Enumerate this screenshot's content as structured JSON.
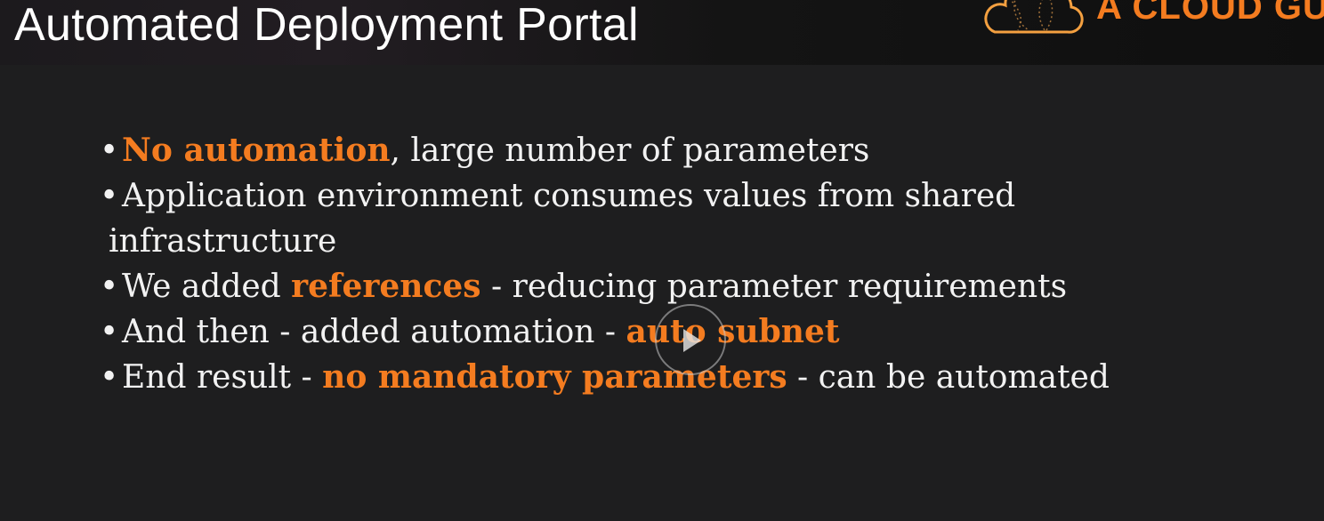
{
  "header": {
    "title": "Automated Deployment Portal",
    "logo_text": "A CLOUD GURU"
  },
  "bullets": [
    {
      "parts": [
        {
          "text": "No automation",
          "highlight": true
        },
        {
          "text": ", large number of parameters"
        }
      ]
    },
    {
      "parts": [
        {
          "text": "Application environment consumes values from shared"
        }
      ],
      "continuation": "infrastructure"
    },
    {
      "parts": [
        {
          "text": "We added "
        },
        {
          "text": "references",
          "highlight": true
        },
        {
          "text": " - reducing parameter requirements"
        }
      ]
    },
    {
      "parts": [
        {
          "text": "And then - added automation - "
        },
        {
          "text": "auto subnet",
          "highlight": true
        }
      ]
    },
    {
      "parts": [
        {
          "text": "End result - "
        },
        {
          "text": "no mandatory parameters",
          "highlight": true
        },
        {
          "text": " - can be automated"
        }
      ]
    }
  ],
  "colors": {
    "accent": "#f47c20",
    "background": "#1e1e1f",
    "header": "#0f0f0f"
  },
  "player": {
    "icon": "play-icon"
  }
}
